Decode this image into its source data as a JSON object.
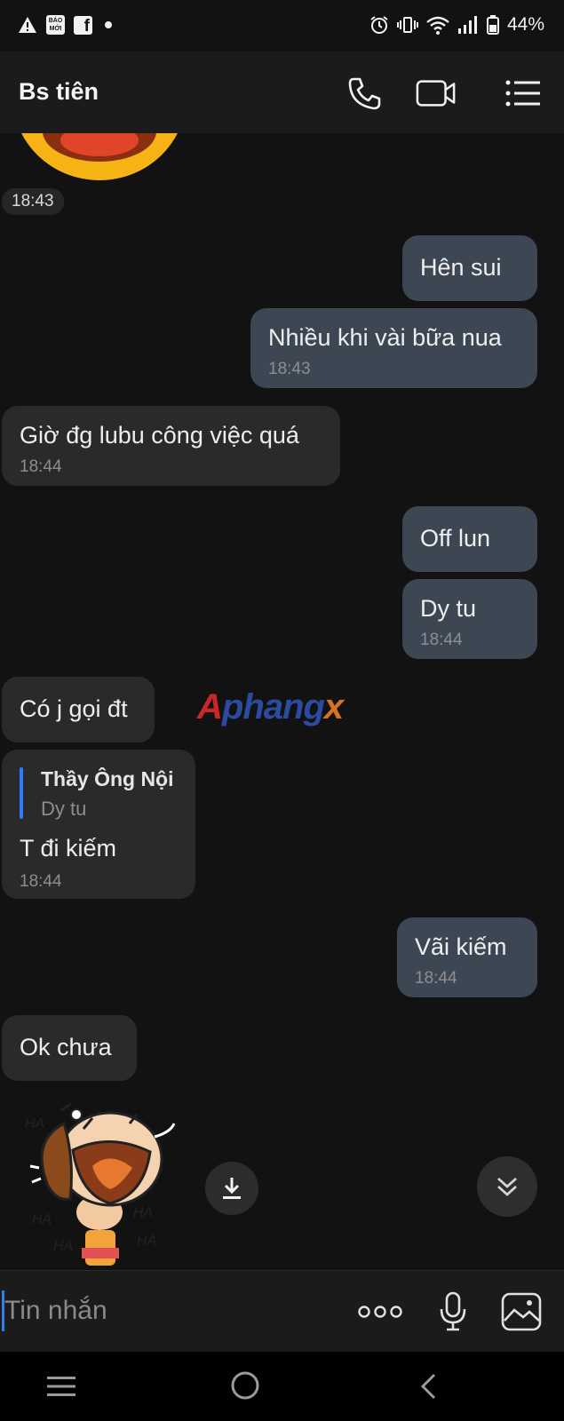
{
  "status_bar": {
    "news_label_line1": "BÁO",
    "news_label_line2": "MỚI",
    "battery": "44%"
  },
  "header": {
    "title": "Bs tiên",
    "call_icon": "phone-icon",
    "video_icon": "video-camera-icon",
    "menu_icon": "list-menu-icon"
  },
  "chat": {
    "date_chip": "18:43",
    "messages": [
      {
        "dir": "out",
        "text": "Hên sui",
        "time": ""
      },
      {
        "dir": "out",
        "text": "Nhiều khi vài bữa nua",
        "time": "18:43"
      },
      {
        "dir": "in",
        "text": "Giờ đg lubu công việc quá",
        "time": "18:44"
      },
      {
        "dir": "out",
        "text": "Off lun",
        "time": ""
      },
      {
        "dir": "out",
        "text": "Dy tu",
        "time": "18:44"
      },
      {
        "dir": "in",
        "text": "Có j gọi đt",
        "time": ""
      },
      {
        "dir": "in",
        "text": "T đi kiếm",
        "time": "18:44",
        "reply_author": "Thầy Ông Nội",
        "reply_text": "Dy tu"
      },
      {
        "dir": "out",
        "text": "Vãi kiếm",
        "time": "18:44"
      },
      {
        "dir": "in",
        "text": "Ok chưa",
        "time": ""
      }
    ],
    "sticker_text": "HA",
    "watermark": "Aphangx",
    "download_icon": "download-icon",
    "scroll_down_icon": "double-chevron-down-icon"
  },
  "composer": {
    "placeholder": "Tin nhắn",
    "more_icon": "more-dots-icon",
    "mic_icon": "microphone-icon",
    "image_icon": "image-icon"
  },
  "nav": {
    "menu_icon": "recent-apps-icon",
    "home_icon": "home-icon",
    "back_icon": "back-icon"
  }
}
